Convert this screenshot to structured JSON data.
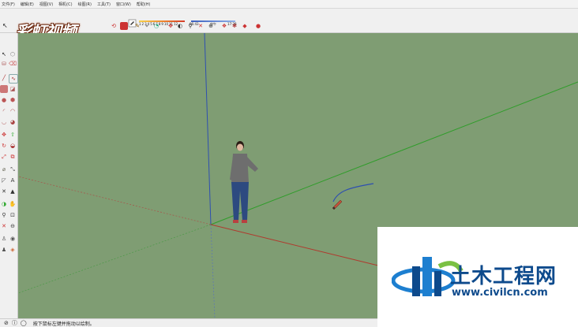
{
  "menubar": {
    "items": [
      "文件(F)",
      "编辑(E)",
      "视图(V)",
      "相机(C)",
      "绘图(R)",
      "工具(T)",
      "窗口(W)",
      "帮助(H)"
    ]
  },
  "brand": {
    "logo_text": "彩虹视频"
  },
  "legend": {
    "ticks": [
      "1",
      "2",
      "3",
      "4",
      "5",
      "6",
      "7",
      "8",
      "9",
      "10",
      "11",
      "12"
    ],
    "left_label": "06:43",
    "mid_label": "中午",
    "right_label": "17:28"
  },
  "statusbar": {
    "hint": "按下鼠标左键并拖动以绘制。"
  },
  "watermark": {
    "title": "土木工程网",
    "url": "www.civilcn.com"
  },
  "colors": {
    "viewport": "#7f9d73",
    "axis_blue": "#2e4fb0",
    "axis_red": "#b03a2e",
    "axis_green": "#2f9d2a",
    "watermark_blue": "#0d4a8c"
  },
  "icons": {
    "top": [
      "color-picker-icon",
      "orbit-icon",
      "make-component-icon",
      "pencil-icon",
      "tape-measure-icon",
      "protractor-icon",
      "move-icon",
      "orbit-view-icon",
      "zoom-icon",
      "zoom-extents-icon",
      "warehouse-icon",
      "extension-icon",
      "ruby-icon",
      "shadow-icon"
    ],
    "left": [
      "select-icon",
      "eraser-icon",
      "line-icon",
      "freehand-icon",
      "rectangle-icon",
      "circle-icon",
      "arc-icon",
      "polygon-icon",
      "move-icon",
      "rotate-icon",
      "push-pull-icon",
      "offset-icon",
      "tape-icon",
      "text-icon",
      "axes-icon",
      "orbit-icon",
      "pan-icon",
      "zoom-icon",
      "walk-icon",
      "look-around-icon",
      "section-icon"
    ]
  }
}
